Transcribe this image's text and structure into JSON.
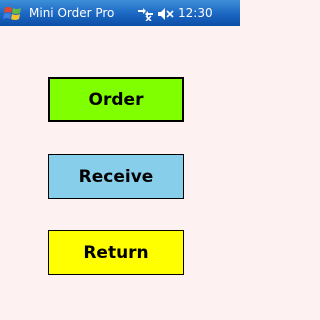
{
  "titlebar": {
    "app_title": "Mini Order Pro",
    "clock": "12:30",
    "start_icon": "windows-start-icon",
    "connectivity_icon": "connectivity-icon",
    "volume_icon": "speaker-muted-icon"
  },
  "main": {
    "buttons": [
      {
        "label": "Order",
        "color": "#80ff00"
      },
      {
        "label": "Receive",
        "color": "#87ceeb"
      },
      {
        "label": "Return",
        "color": "#ffff00"
      }
    ]
  },
  "colors": {
    "titlebar": "#1a66c2",
    "background": "#fdf2f1"
  }
}
